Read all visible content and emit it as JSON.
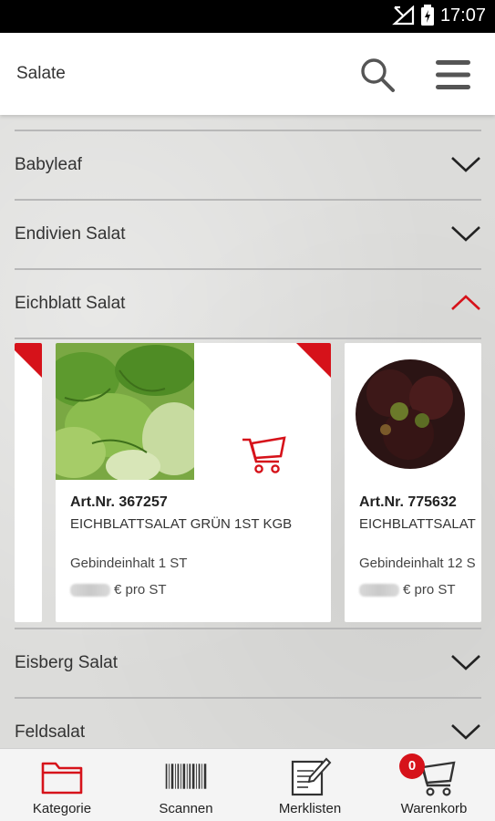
{
  "status_bar": {
    "time": "17:07",
    "icons": [
      "signal-icon",
      "battery-icon"
    ]
  },
  "app_bar": {
    "title": "Salate",
    "icons": [
      "search-icon",
      "hamburger-menu-icon"
    ]
  },
  "categories": [
    {
      "label": "Babyleaf",
      "expanded": false
    },
    {
      "label": "Endivien Salat",
      "expanded": false
    },
    {
      "label": "Eichblatt Salat",
      "expanded": true
    },
    {
      "label": "Eisberg Salat",
      "expanded": false
    },
    {
      "label": "Feldsalat",
      "expanded": false
    }
  ],
  "products": [
    {
      "art_nr": "Art.Nr. 367257",
      "name": "EICHBLATTSALAT GRÜN 1ST KGB",
      "pack": "Gebindeinhalt 1 ST",
      "price_unit": "€ pro ST",
      "image": "green-oak-leaf-lettuce"
    },
    {
      "art_nr": "Art.Nr. 775632",
      "name": "EICHBLATTSALAT",
      "pack": "Gebindeinhalt 12 S",
      "price_unit": "€ pro ST",
      "image": "red-oak-leaf-lettuce"
    }
  ],
  "bottom_nav": [
    {
      "label": "Kategorie",
      "icon": "folder-icon",
      "active": true
    },
    {
      "label": "Scannen",
      "icon": "barcode-icon",
      "active": false
    },
    {
      "label": "Merklisten",
      "icon": "notepad-icon",
      "active": false
    },
    {
      "label": "Warenkorb",
      "icon": "cart-icon",
      "active": false
    }
  ],
  "cart_count": "0",
  "colors": {
    "accent": "#d6121a",
    "text": "#333333",
    "background": "#dcdcda"
  }
}
